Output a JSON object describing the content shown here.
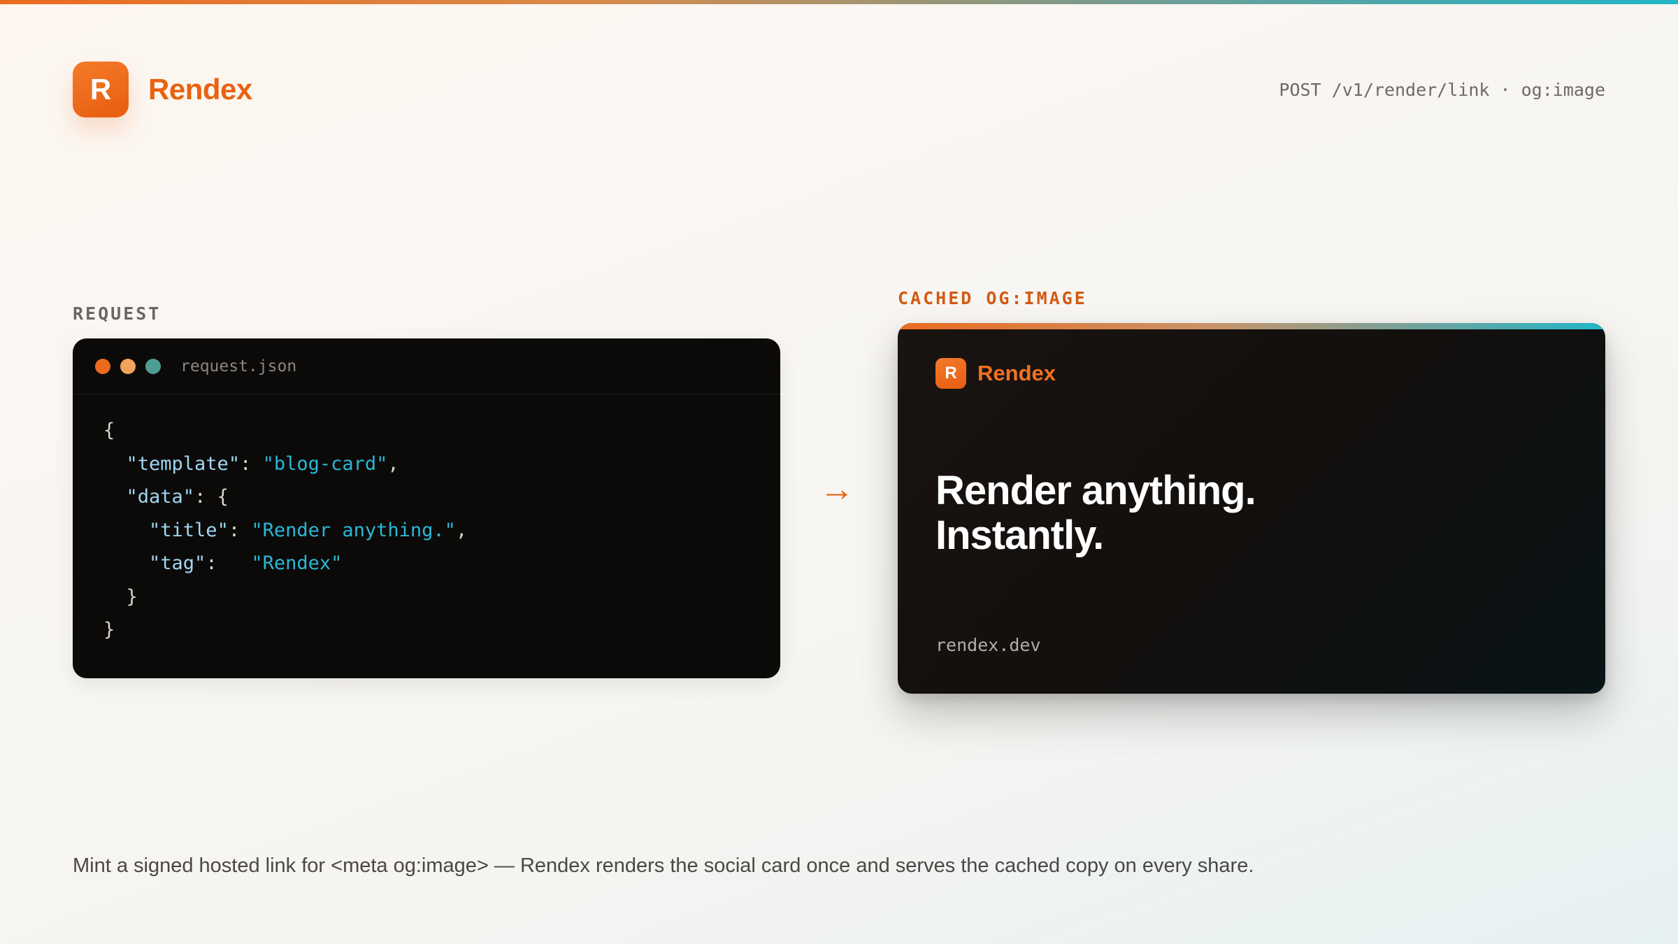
{
  "brand": {
    "initial": "R",
    "name": "Rendex"
  },
  "endpoint": "POST /v1/render/link · og:image",
  "request": {
    "label": "REQUEST",
    "filename": "request.json",
    "json": {
      "open_brace": "{",
      "template_key": "\"template\"",
      "template_value": "\"blog-card\"",
      "data_key": "\"data\"",
      "title_key": "\"title\"",
      "title_value": "\"Render anything.\"",
      "tag_key": "\"tag\"",
      "tag_value": "\"Rendex\"",
      "inner_close": "}",
      "close_brace": "}"
    }
  },
  "arrow": "→",
  "cached": {
    "label": "CACHED OG:IMAGE",
    "card": {
      "brand_initial": "R",
      "brand_name": "Rendex",
      "title_line1": "Render anything.",
      "title_line2": "Instantly.",
      "domain": "rendex.dev"
    }
  },
  "caption": "Mint a signed hosted link for <meta og:image> — Rendex renders the social card once and serves the cached copy on every share.",
  "colors": {
    "accent": "#e8620f",
    "string": "#2ab8d6",
    "key": "#9fd6f2",
    "code_bg": "#0b0a09",
    "dot_orange": "#ec6a1e",
    "dot_amber": "#f1a35c",
    "dot_teal": "#4e9c93"
  }
}
